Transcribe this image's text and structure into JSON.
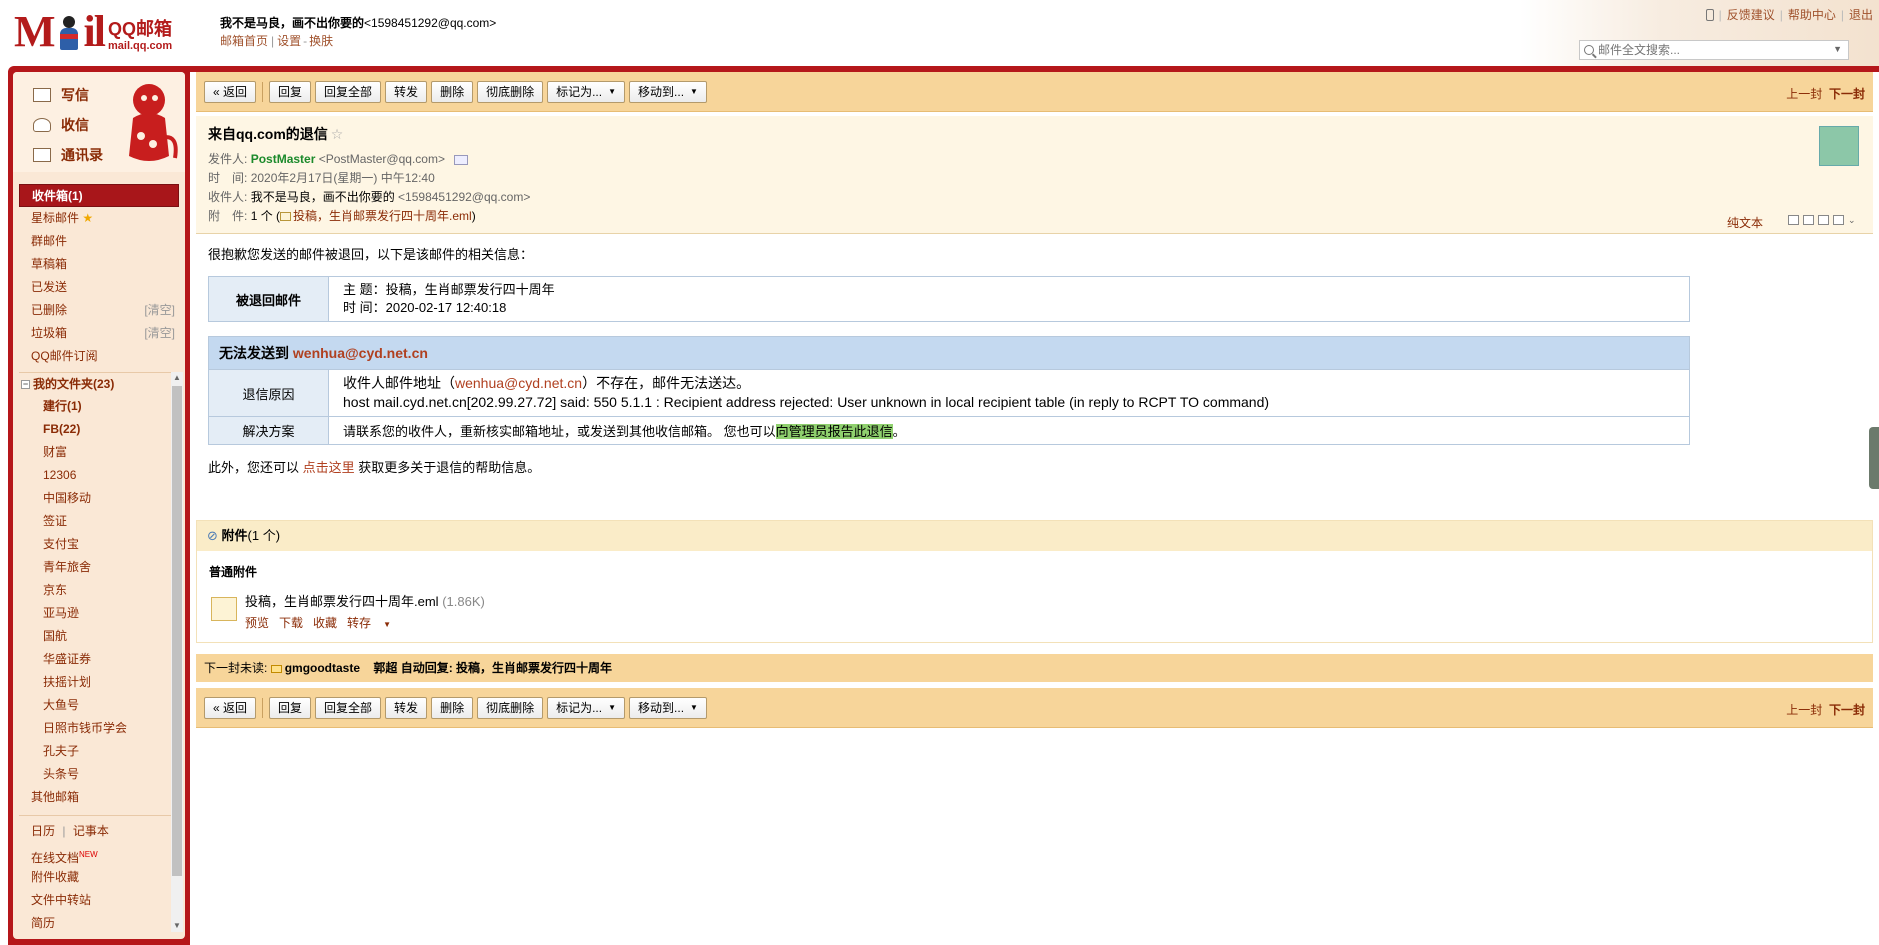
{
  "header": {
    "logo_mail": "M",
    "logo_mail2": "il",
    "brand": "QQ邮箱",
    "domain": "mail.qq.com",
    "user_name": "我不是马良，画不出你要的",
    "user_email": "<1598451292@qq.com>",
    "home_link": "邮箱首页",
    "settings_link": "设置",
    "switch_link": "换肤",
    "feedback": "反馈建议",
    "help": "帮助中心",
    "logout": "退出",
    "search_placeholder": "邮件全文搜索..."
  },
  "quick": {
    "write": "写信",
    "inbox": "收信",
    "contacts": "通讯录"
  },
  "folders": {
    "inbox": "收件箱(1)",
    "starred": "星标邮件",
    "group": "群邮件",
    "drafts": "草稿箱",
    "sent": "已发送",
    "deleted": "已删除",
    "deleted_clear": "[清空]",
    "spam": "垃圾箱",
    "spam_clear": "[清空]",
    "subscription": "QQ邮件订阅",
    "my_folders": "我的文件夹(23)",
    "custom": [
      {
        "label": "建行(1)",
        "bold": true
      },
      {
        "label": "FB(22)",
        "bold": true
      },
      {
        "label": "财富",
        "bold": false
      },
      {
        "label": "12306",
        "bold": false
      },
      {
        "label": "中国移动",
        "bold": false
      },
      {
        "label": "签证",
        "bold": false
      },
      {
        "label": "支付宝",
        "bold": false
      },
      {
        "label": "青年旅舍",
        "bold": false
      },
      {
        "label": "京东",
        "bold": false
      },
      {
        "label": "亚马逊",
        "bold": false
      },
      {
        "label": "国航",
        "bold": false
      },
      {
        "label": "华盛证券",
        "bold": false
      },
      {
        "label": "扶摇计划",
        "bold": false
      },
      {
        "label": "大鱼号",
        "bold": false
      },
      {
        "label": "日照市钱币学会",
        "bold": false
      },
      {
        "label": "孔夫子",
        "bold": false
      },
      {
        "label": "头条号",
        "bold": false
      }
    ],
    "other": "其他邮箱",
    "calendar": "日历",
    "notes": "记事本",
    "docs": "在线文档",
    "docs_badge": "NEW",
    "att_fav": "附件收藏",
    "transfer": "文件中转站",
    "resume": "简历"
  },
  "toolbar": {
    "back": "« 返回",
    "reply": "回复",
    "reply_all": "回复全部",
    "forward": "转发",
    "delete": "删除",
    "perm_delete": "彻底删除",
    "mark_as": "标记为...",
    "move_to": "移动到...",
    "prev": "上一封",
    "next": "下一封"
  },
  "message": {
    "subject": "来自qq.com的退信",
    "from_label": "发件人:",
    "from_name": "PostMaster",
    "from_email": "<PostMaster@qq.com>",
    "time_label": "时　间:",
    "time": "2020年2月17日(星期一) 中午12:40",
    "to_label": "收件人:",
    "to_name": "我不是马良，画不出你要的",
    "to_email": "<1598451292@qq.com>",
    "att_label": "附　件:",
    "att_count": "1 个 (",
    "att_name": "投稿，生肖邮票发行四十周年.eml",
    "att_close": ")",
    "plaintext": "纯文本"
  },
  "body": {
    "intro": "很抱歉您发送的邮件被退回，以下是该邮件的相关信息：",
    "bounced_label": "被退回邮件",
    "subject_line": "主 题：投稿，生肖邮票发行四十周年",
    "time_line": "时 间：2020-02-17 12:40:18",
    "fail_prefix": "无法发送到",
    "fail_addr": "wenhua@cyd.net.cn",
    "reason_label": "退信原因",
    "reason_pre": "收件人邮件地址（",
    "reason_addr": "wenhua@cyd.net.cn",
    "reason_post": "）不存在，邮件无法送达。",
    "reason_smtp": "host mail.cyd.net.cn[202.99.27.72] said: 550 5.1.1 : Recipient address rejected: User unknown in local recipient table (in reply to RCPT TO command)",
    "solution_label": "解决方案",
    "solution_text": "请联系您的收件人，重新核实邮箱地址，或发送到其他收信邮箱。 您也可以",
    "solution_link": "向管理员报告此退信",
    "solution_end": "。",
    "extra_pre": "此外，您还可以",
    "extra_link": "点击这里",
    "extra_post": "获取更多关于退信的帮助信息。"
  },
  "attachments": {
    "title": "附件",
    "count": "(1 个)",
    "section": "普通附件",
    "file_name": "投稿，生肖邮票发行四十周年.eml",
    "file_size": "(1.86K)",
    "preview": "预览",
    "download": "下载",
    "favorite": "收藏",
    "save_to": "转存"
  },
  "next_unread": {
    "label": "下一封未读:",
    "sender": "gmgoodtaste",
    "subject": "郭超 自动回复: 投稿，生肖邮票发行四十周年"
  },
  "colors": {
    "brand_red": "#b5171a",
    "toolbar_bg": "#f7d59a",
    "sidebar_bg": "#fae8d6",
    "table_header_bg": "#c4d9f0",
    "highlight_green": "#8fd06e"
  }
}
